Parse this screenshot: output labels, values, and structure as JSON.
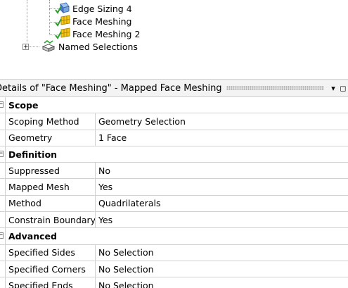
{
  "tree": {
    "items": [
      {
        "label": "Edge Sizing 4",
        "icon": "edge-sizing-icon",
        "checked": true
      },
      {
        "label": "Face Meshing",
        "icon": "face-meshing-icon",
        "checked": true
      },
      {
        "label": "Face Meshing 2",
        "icon": "face-meshing-icon",
        "checked": true
      },
      {
        "label": "Named Selections",
        "icon": "named-selections-icon",
        "expander": "+"
      }
    ]
  },
  "details": {
    "title": "Details of \"Face Meshing\" - Mapped Face Meshing",
    "pin_glyph": "▾",
    "close_glyph": "◻",
    "collapse_glyph": "−",
    "groups": [
      {
        "label": "Scope",
        "rows": [
          {
            "name": "Scoping Method",
            "value": "Geometry Selection"
          },
          {
            "name": "Geometry",
            "value": "1 Face"
          }
        ]
      },
      {
        "label": "Definition",
        "rows": [
          {
            "name": "Suppressed",
            "value": "No"
          },
          {
            "name": "Mapped Mesh",
            "value": "Yes"
          },
          {
            "name": "Method",
            "value": "Quadrilaterals"
          },
          {
            "name": "Constrain Boundary",
            "value": "Yes"
          }
        ]
      },
      {
        "label": "Advanced",
        "rows": [
          {
            "name": "Specified Sides",
            "value": "No Selection"
          },
          {
            "name": "Specified Corners",
            "value": "No Selection"
          },
          {
            "name": "Specified Ends",
            "value": "No Selection"
          }
        ]
      }
    ]
  },
  "colors": {
    "check_green": "#2e9e2e",
    "icon_yellow": "#e8b800",
    "edge_blue": "#4a78c8"
  }
}
